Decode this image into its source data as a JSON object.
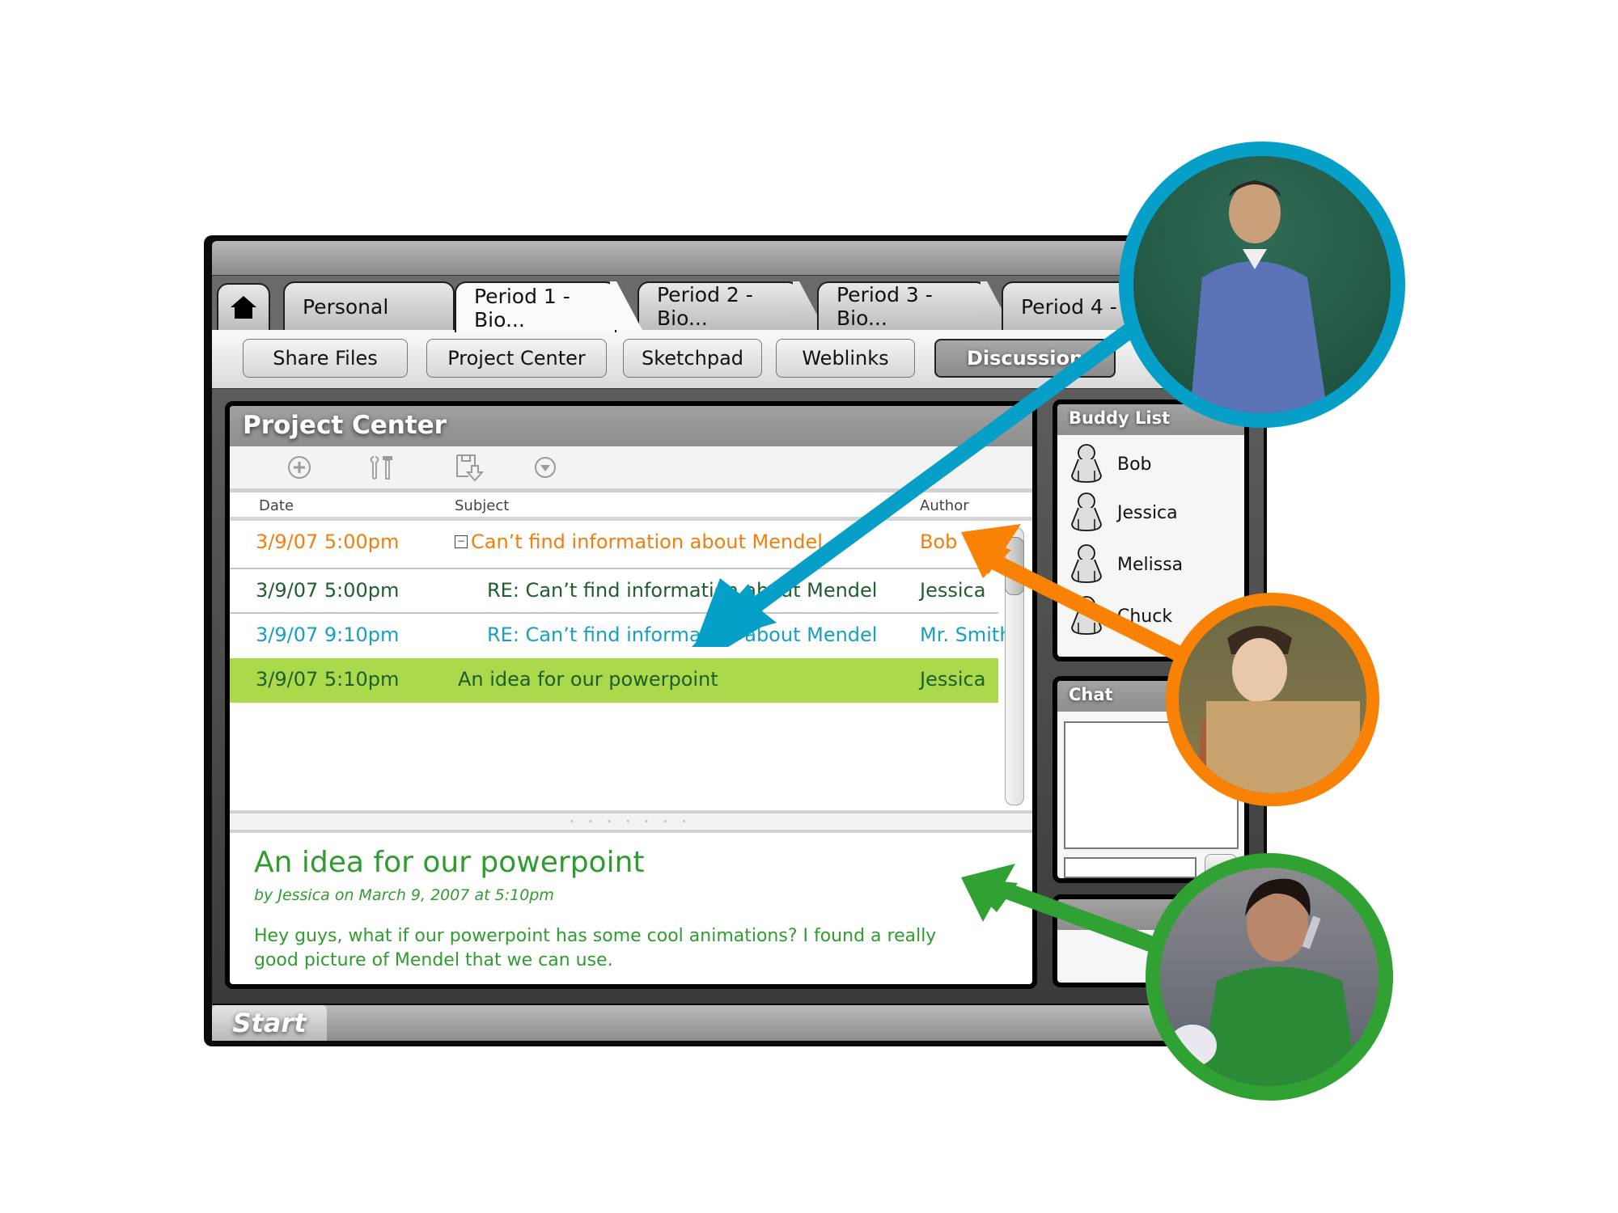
{
  "window": {
    "home_icon": "home-icon",
    "tabs": [
      {
        "label": "Personal",
        "active": false
      },
      {
        "label": "Period 1 - Bio...",
        "active": true
      },
      {
        "label": "Period 2 - Bio...",
        "active": false
      },
      {
        "label": "Period 3 - Bio...",
        "active": false
      },
      {
        "label": "Period 4 -",
        "active": false
      }
    ],
    "nav_buttons": [
      {
        "label": "Share Files",
        "active": false
      },
      {
        "label": "Project Center",
        "active": false
      },
      {
        "label": "Sketchpad",
        "active": false
      },
      {
        "label": "Weblinks",
        "active": false
      },
      {
        "label": "Discussion",
        "active": true
      }
    ]
  },
  "project_center": {
    "title": "Project Center",
    "toolbar_icons": [
      "add-circle-icon",
      "tools-icon",
      "save-download-icon",
      "chevron-down-circle-icon"
    ],
    "columns": {
      "date": "Date",
      "subject": "Subject",
      "author": "Author"
    },
    "rows": [
      {
        "date": "3/9/07  5:00pm",
        "subject": "Can’t find information about Mendel",
        "author": "Bob",
        "color": "#f27e0d",
        "indent": 0,
        "collapsible": true,
        "collapse_glyph": "−"
      },
      {
        "date": "3/9/07  5:00pm",
        "subject": "RE: Can’t find information about Mendel",
        "author": "Jessica",
        "color": "#1f5e2c",
        "indent": 1
      },
      {
        "date": "3/9/07  9:10pm",
        "subject": "RE: Can’t find information about Mendel",
        "author": "Mr. Smith",
        "color": "#169fc5",
        "indent": 1
      },
      {
        "date": "3/9/07  5:10pm",
        "subject": "An idea for our powerpoint",
        "author": "Jessica",
        "color": "#1f5e2c",
        "indent": 0,
        "selected": true
      }
    ],
    "splitter_grip": "• • • • • • •",
    "message": {
      "title": "An idea for our powerpoint",
      "meta": "by Jessica on March 9, 2007 at 5:10pm",
      "body": "Hey guys, what if our powerpoint has some cool animations? I found a really good picture of Mendel that we can use."
    }
  },
  "buddy_list": {
    "title": "Buddy List",
    "buddies": [
      "Bob",
      "Jessica",
      "Melissa",
      "Chuck"
    ]
  },
  "chat": {
    "title": "Chat",
    "log": "",
    "input_value": ""
  },
  "taskbar": {
    "start_label": "Start"
  },
  "colors": {
    "teacher_ring": "#059fc7",
    "bob_ring": "#f98205",
    "jessica_ring": "#2fa233",
    "selected_row": "#aad94c",
    "message_text": "#2f9c2f"
  },
  "overlays": [
    {
      "name": "teacher-photo",
      "ring_color": "#059fc7",
      "arrow_target": "Mr. Smith reply row"
    },
    {
      "name": "student-bob-photo",
      "ring_color": "#f98205",
      "arrow_target": "Bob author"
    },
    {
      "name": "student-jessica-photo",
      "ring_color": "#2fa233",
      "arrow_target": "message preview"
    }
  ]
}
